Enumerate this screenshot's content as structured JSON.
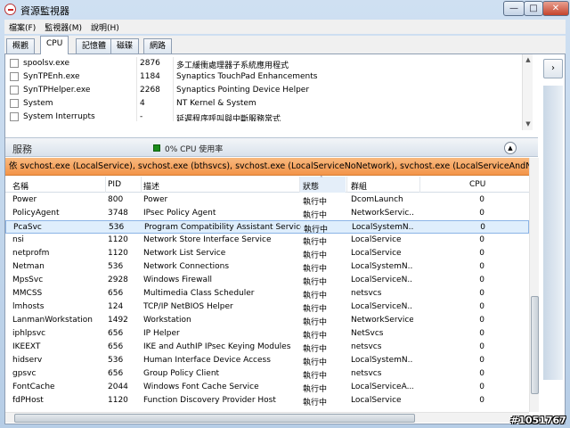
{
  "window": {
    "title": "資源監視器",
    "min_glyph": "—",
    "max_glyph": "□",
    "close_glyph": "✕"
  },
  "menu": {
    "items": [
      "檔案(F)",
      "監視器(M)",
      "說明(H)"
    ]
  },
  "tabs": [
    "概觀",
    "CPU",
    "記憶體",
    "磁碟",
    "網路"
  ],
  "active_tab": "CPU",
  "processes": [
    {
      "name": "spoolsv.exe",
      "pid": "2876",
      "desc": "多工緩衝處理器子系統應用程式"
    },
    {
      "name": "SynTPEnh.exe",
      "pid": "1184",
      "desc": "Synaptics TouchPad Enhancements"
    },
    {
      "name": "SynTPHelper.exe",
      "pid": "2268",
      "desc": "Synaptics Pointing Device Helper"
    },
    {
      "name": "System",
      "pid": "4",
      "desc": "NT Kernel & System"
    },
    {
      "name": "System Interrupts",
      "pid": "-",
      "desc": "延遲程序呼叫與中斷服務常式"
    }
  ],
  "services": {
    "title": "服務",
    "cpu_usage": "0% CPU 使用率",
    "filter": "依 svchost.exe (LocalService), svchost.exe (bthsvcs), svchost.exe (LocalServiceNoNetwork), svchost.exe (LocalServiceAndNoImp...",
    "columns": [
      "名稱",
      "PID",
      "描述",
      "狀態",
      "群組",
      "CPU"
    ],
    "rows": [
      {
        "name": "Power",
        "pid": "800",
        "desc": "Power",
        "status": "執行中",
        "group": "DcomLaunch",
        "cpu": "0"
      },
      {
        "name": "PolicyAgent",
        "pid": "3748",
        "desc": "IPsec Policy Agent",
        "status": "執行中",
        "group": "NetworkServic...",
        "cpu": "0"
      },
      {
        "name": "PcaSvc",
        "pid": "536",
        "desc": "Program Compatibility Assistant Service",
        "status": "執行中",
        "group": "LocalSystemN...",
        "cpu": "0"
      },
      {
        "name": "nsi",
        "pid": "1120",
        "desc": "Network Store Interface Service",
        "status": "執行中",
        "group": "LocalService",
        "cpu": "0"
      },
      {
        "name": "netprofm",
        "pid": "1120",
        "desc": "Network List Service",
        "status": "執行中",
        "group": "LocalService",
        "cpu": "0"
      },
      {
        "name": "Netman",
        "pid": "536",
        "desc": "Network Connections",
        "status": "執行中",
        "group": "LocalSystemN...",
        "cpu": "0"
      },
      {
        "name": "MpsSvc",
        "pid": "2928",
        "desc": "Windows Firewall",
        "status": "執行中",
        "group": "LocalServiceN...",
        "cpu": "0"
      },
      {
        "name": "MMCSS",
        "pid": "656",
        "desc": "Multimedia Class Scheduler",
        "status": "執行中",
        "group": "netsvcs",
        "cpu": "0"
      },
      {
        "name": "lmhosts",
        "pid": "124",
        "desc": "TCP/IP NetBIOS Helper",
        "status": "執行中",
        "group": "LocalServiceN...",
        "cpu": "0"
      },
      {
        "name": "LanmanWorkstation",
        "pid": "1492",
        "desc": "Workstation",
        "status": "執行中",
        "group": "NetworkService",
        "cpu": "0"
      },
      {
        "name": "iphlpsvc",
        "pid": "656",
        "desc": "IP Helper",
        "status": "執行中",
        "group": "NetSvcs",
        "cpu": "0"
      },
      {
        "name": "IKEEXT",
        "pid": "656",
        "desc": "IKE and AuthIP IPsec Keying Modules",
        "status": "執行中",
        "group": "netsvcs",
        "cpu": "0"
      },
      {
        "name": "hidserv",
        "pid": "536",
        "desc": "Human Interface Device Access",
        "status": "執行中",
        "group": "LocalSystemN...",
        "cpu": "0"
      },
      {
        "name": "gpsvc",
        "pid": "656",
        "desc": "Group Policy Client",
        "status": "執行中",
        "group": "netsvcs",
        "cpu": "0"
      },
      {
        "name": "FontCache",
        "pid": "2044",
        "desc": "Windows Font Cache Service",
        "status": "執行中",
        "group": "LocalServiceA...",
        "cpu": "0"
      },
      {
        "name": "fdPHost",
        "pid": "1120",
        "desc": "Function Discovery Provider Host",
        "status": "執行中",
        "group": "LocalService",
        "cpu": "0"
      }
    ],
    "selected_row": "PcaSvc"
  },
  "watermark": "#1051767"
}
